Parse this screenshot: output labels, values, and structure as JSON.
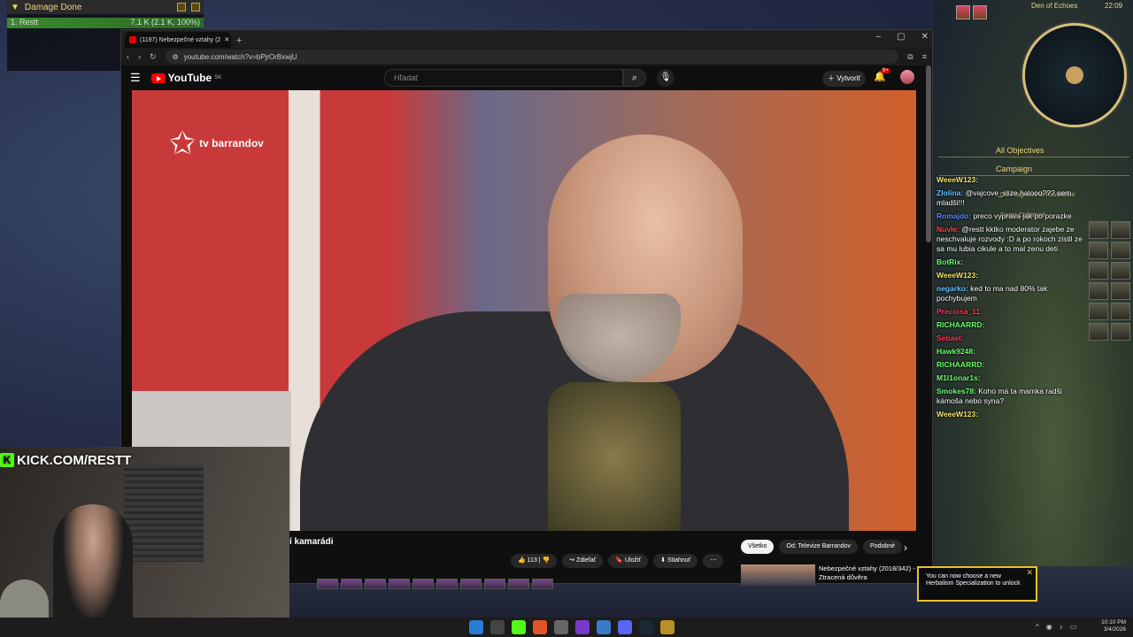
{
  "damage_meter": {
    "title": "Damage Done",
    "row_name": "1. Restt",
    "row_value": "7.1 K (2.1 K, 100%)"
  },
  "browser": {
    "tab_title": "(1197) Nebezpečné vztahy (2",
    "url": "youtube.com/watch?v=bPjrOrBxwjU",
    "new_tab": "+",
    "window_controls": [
      "–",
      "▢",
      "✕"
    ]
  },
  "youtube": {
    "logo": "YouTube",
    "region": "SK",
    "search_placeholder": "Hľadať",
    "create_label": "Vytvoriť",
    "notif_count": "9+",
    "video_channel_logo": "tv barrandov",
    "video_title": "í kamarádi",
    "like_count": "113",
    "share_label": "Zdieľať",
    "save_label": "Uložiť",
    "download_label": "Stiahnuť",
    "chips": [
      "Všetko",
      "Od: Televize Barrandov",
      "Podobné"
    ],
    "rec_title": "Nebezpečné vztahy (2018/342) - Ztracená důvěra"
  },
  "webcam": {
    "kick_url": "KICK.COM/RESTT"
  },
  "objectives": {
    "all": "All Objectives",
    "campaign": "Campaign",
    "sub1": "0/1 Fragment of Revelation",
    "sub2": "Cargo Collateral"
  },
  "chat": [
    {
      "user": "WeeeW123:",
      "text": "",
      "color": "#f4e36a"
    },
    {
      "user": "Zlolina:",
      "text": "@vajcove_slize halooo??? sem mladši!!!",
      "color": "#6ac0ff"
    },
    {
      "user": "Romajdo:",
      "text": "preco vyprava jak po porazke",
      "color": "#5a8aff"
    },
    {
      "user": "Nuvle:",
      "text": "@restt kktko moderator zajebe ze neschvaluje rozvody :D a po rokoch zistil ze sa mu lubia cikule a to mal zenu deti",
      "color": "#ff4a4a"
    },
    {
      "user": "BotRix:",
      "text": "",
      "color": "#6aff6a"
    },
    {
      "user": "WeeeW123:",
      "text": "",
      "color": "#f4e36a"
    },
    {
      "user": "negarko:",
      "text": "ked to ma nad 80% tak pochybujem",
      "color": "#6ac0ff"
    },
    {
      "user": "Preciosa_11:",
      "text": "",
      "color": "#ff3a5a"
    },
    {
      "user": "RICHAARRD:",
      "text": "",
      "color": "#6aff6a"
    },
    {
      "user": "Sebast:",
      "text": "",
      "color": "#ff3a5a"
    },
    {
      "user": "Hawk9248:",
      "text": "",
      "color": "#6aff6a"
    },
    {
      "user": "RICHAARRD:",
      "text": "",
      "color": "#6aff6a"
    },
    {
      "user": "M1l1onar1s:",
      "text": "",
      "color": "#6aff6a"
    },
    {
      "user": "Smokes78:",
      "text": "Koho má ta mamka radši kámoša nebo syna?",
      "color": "#6aff6a"
    },
    {
      "user": "WeeeW123:",
      "text": "",
      "color": "#f4e36a"
    }
  ],
  "game": {
    "zone": "Den of Echoes",
    "clock": "22:09",
    "toast": "You can now choose a new Herbalism Specialization to unlock"
  },
  "taskbar": {
    "time": "10:10 PM",
    "date": "3/4/2026"
  },
  "colors": {
    "accent": "#f4d27a",
    "kick_green": "#53fc18",
    "yt_red": "#ff0000"
  }
}
